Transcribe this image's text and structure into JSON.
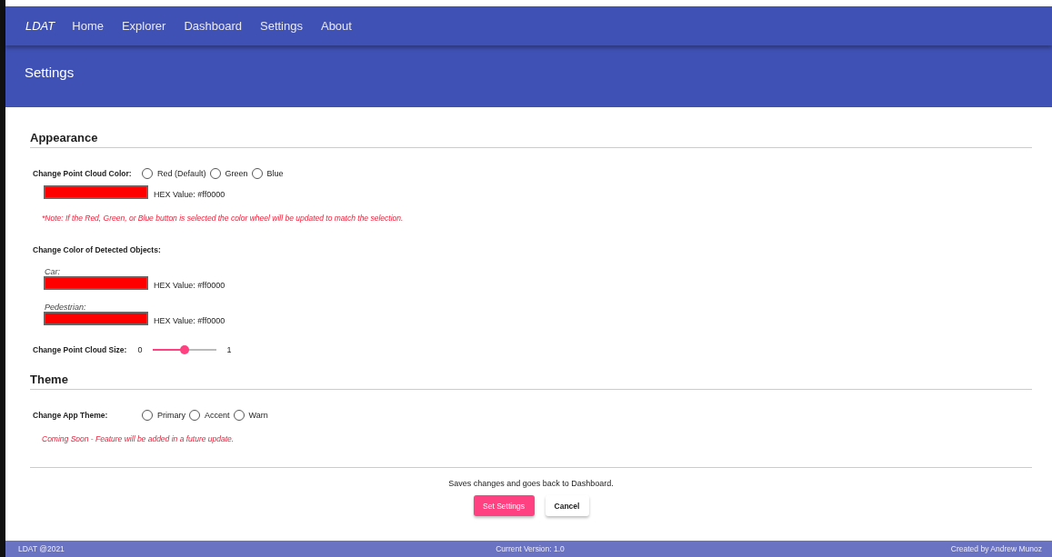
{
  "toolbar": {
    "brand": "LDAT",
    "links": [
      {
        "label": "Home"
      },
      {
        "label": "Explorer"
      },
      {
        "label": "Dashboard"
      },
      {
        "label": "Settings"
      },
      {
        "label": "About"
      }
    ]
  },
  "page_header": {
    "title": "Settings"
  },
  "sections": [
    {
      "heading": "Appearance",
      "rows": [
        {
          "kind": "radio",
          "label": "Change Point Cloud Color:",
          "options": [
            {
              "label": "Red (Default)",
              "selected": false
            },
            {
              "label": "Green",
              "selected": false
            },
            {
              "label": "Blue",
              "selected": false
            }
          ]
        },
        {
          "kind": "color",
          "color": "#ff0000",
          "hex": "HEX Value: #ff0000"
        },
        {
          "kind": "note",
          "text": "*Note: If the Red, Green, or Blue button is selected the color wheel will be updated to match the selection."
        },
        {
          "kind": "subheading",
          "text": "Change Color of Detected Objects:"
        },
        {
          "kind": "color",
          "caption": "Car:",
          "color": "#ff0000",
          "hex": "HEX Value: #ff0000"
        },
        {
          "kind": "color",
          "caption": "Pedestrian:",
          "color": "#ff0000",
          "hex": "HEX Value: #ff0000"
        },
        {
          "kind": "slider",
          "label": "Change Point Cloud Size:",
          "min": "0",
          "max": "1",
          "level": 0.5
        }
      ]
    },
    {
      "heading": "Theme",
      "rows": [
        {
          "kind": "radio",
          "label": "Change App Theme:",
          "options": [
            {
              "label": "Primary",
              "selected": false
            },
            {
              "label": "Accent",
              "selected": false
            },
            {
              "label": "Warn",
              "selected": false
            }
          ]
        },
        {
          "kind": "note",
          "text": "Coming Soon - Feature will be added in a future update."
        }
      ]
    }
  ],
  "actions": {
    "hint": "Saves changes and goes back to Dashboard.",
    "buttons": [
      {
        "label": "Set Settings",
        "kind": "primary"
      },
      {
        "label": "Cancel",
        "kind": "plain"
      }
    ]
  },
  "footer": {
    "left": "LDAT @2021",
    "center": "Current Version: 1.0",
    "right": "Created by Andrew Munoz"
  }
}
